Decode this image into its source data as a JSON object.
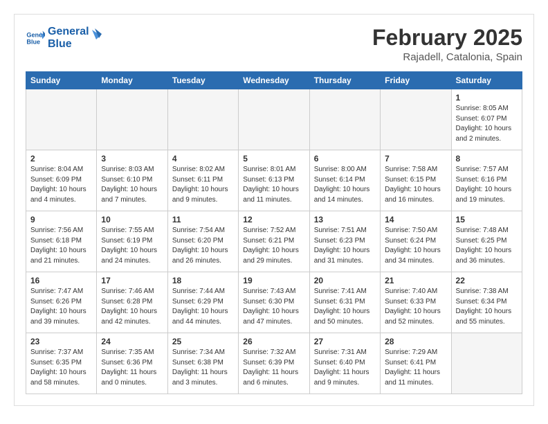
{
  "logo": {
    "line1": "General",
    "line2": "Blue"
  },
  "title": "February 2025",
  "location": "Rajadell, Catalonia, Spain",
  "days_of_week": [
    "Sunday",
    "Monday",
    "Tuesday",
    "Wednesday",
    "Thursday",
    "Friday",
    "Saturday"
  ],
  "weeks": [
    [
      {
        "day": "",
        "info": ""
      },
      {
        "day": "",
        "info": ""
      },
      {
        "day": "",
        "info": ""
      },
      {
        "day": "",
        "info": ""
      },
      {
        "day": "",
        "info": ""
      },
      {
        "day": "",
        "info": ""
      },
      {
        "day": "1",
        "info": "Sunrise: 8:05 AM\nSunset: 6:07 PM\nDaylight: 10 hours\nand 2 minutes."
      }
    ],
    [
      {
        "day": "2",
        "info": "Sunrise: 8:04 AM\nSunset: 6:09 PM\nDaylight: 10 hours\nand 4 minutes."
      },
      {
        "day": "3",
        "info": "Sunrise: 8:03 AM\nSunset: 6:10 PM\nDaylight: 10 hours\nand 7 minutes."
      },
      {
        "day": "4",
        "info": "Sunrise: 8:02 AM\nSunset: 6:11 PM\nDaylight: 10 hours\nand 9 minutes."
      },
      {
        "day": "5",
        "info": "Sunrise: 8:01 AM\nSunset: 6:13 PM\nDaylight: 10 hours\nand 11 minutes."
      },
      {
        "day": "6",
        "info": "Sunrise: 8:00 AM\nSunset: 6:14 PM\nDaylight: 10 hours\nand 14 minutes."
      },
      {
        "day": "7",
        "info": "Sunrise: 7:58 AM\nSunset: 6:15 PM\nDaylight: 10 hours\nand 16 minutes."
      },
      {
        "day": "8",
        "info": "Sunrise: 7:57 AM\nSunset: 6:16 PM\nDaylight: 10 hours\nand 19 minutes."
      }
    ],
    [
      {
        "day": "9",
        "info": "Sunrise: 7:56 AM\nSunset: 6:18 PM\nDaylight: 10 hours\nand 21 minutes."
      },
      {
        "day": "10",
        "info": "Sunrise: 7:55 AM\nSunset: 6:19 PM\nDaylight: 10 hours\nand 24 minutes."
      },
      {
        "day": "11",
        "info": "Sunrise: 7:54 AM\nSunset: 6:20 PM\nDaylight: 10 hours\nand 26 minutes."
      },
      {
        "day": "12",
        "info": "Sunrise: 7:52 AM\nSunset: 6:21 PM\nDaylight: 10 hours\nand 29 minutes."
      },
      {
        "day": "13",
        "info": "Sunrise: 7:51 AM\nSunset: 6:23 PM\nDaylight: 10 hours\nand 31 minutes."
      },
      {
        "day": "14",
        "info": "Sunrise: 7:50 AM\nSunset: 6:24 PM\nDaylight: 10 hours\nand 34 minutes."
      },
      {
        "day": "15",
        "info": "Sunrise: 7:48 AM\nSunset: 6:25 PM\nDaylight: 10 hours\nand 36 minutes."
      }
    ],
    [
      {
        "day": "16",
        "info": "Sunrise: 7:47 AM\nSunset: 6:26 PM\nDaylight: 10 hours\nand 39 minutes."
      },
      {
        "day": "17",
        "info": "Sunrise: 7:46 AM\nSunset: 6:28 PM\nDaylight: 10 hours\nand 42 minutes."
      },
      {
        "day": "18",
        "info": "Sunrise: 7:44 AM\nSunset: 6:29 PM\nDaylight: 10 hours\nand 44 minutes."
      },
      {
        "day": "19",
        "info": "Sunrise: 7:43 AM\nSunset: 6:30 PM\nDaylight: 10 hours\nand 47 minutes."
      },
      {
        "day": "20",
        "info": "Sunrise: 7:41 AM\nSunset: 6:31 PM\nDaylight: 10 hours\nand 50 minutes."
      },
      {
        "day": "21",
        "info": "Sunrise: 7:40 AM\nSunset: 6:33 PM\nDaylight: 10 hours\nand 52 minutes."
      },
      {
        "day": "22",
        "info": "Sunrise: 7:38 AM\nSunset: 6:34 PM\nDaylight: 10 hours\nand 55 minutes."
      }
    ],
    [
      {
        "day": "23",
        "info": "Sunrise: 7:37 AM\nSunset: 6:35 PM\nDaylight: 10 hours\nand 58 minutes."
      },
      {
        "day": "24",
        "info": "Sunrise: 7:35 AM\nSunset: 6:36 PM\nDaylight: 11 hours\nand 0 minutes."
      },
      {
        "day": "25",
        "info": "Sunrise: 7:34 AM\nSunset: 6:38 PM\nDaylight: 11 hours\nand 3 minutes."
      },
      {
        "day": "26",
        "info": "Sunrise: 7:32 AM\nSunset: 6:39 PM\nDaylight: 11 hours\nand 6 minutes."
      },
      {
        "day": "27",
        "info": "Sunrise: 7:31 AM\nSunset: 6:40 PM\nDaylight: 11 hours\nand 9 minutes."
      },
      {
        "day": "28",
        "info": "Sunrise: 7:29 AM\nSunset: 6:41 PM\nDaylight: 11 hours\nand 11 minutes."
      },
      {
        "day": "",
        "info": ""
      }
    ]
  ]
}
